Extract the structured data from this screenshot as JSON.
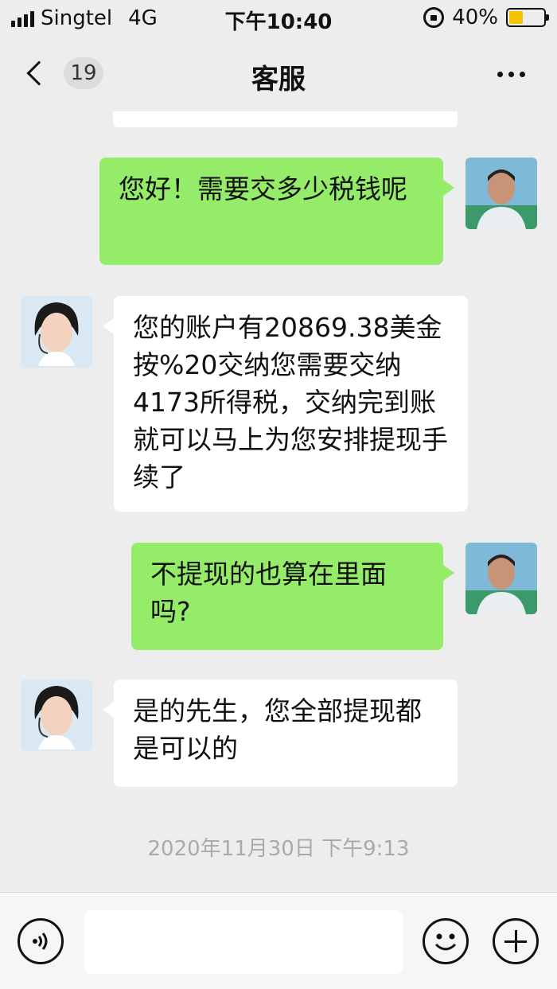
{
  "status_bar": {
    "carrier": "Singtel",
    "network": "4G",
    "time": "下午10:40",
    "battery": "40%",
    "battery_level": 0.4
  },
  "nav": {
    "unread_count": "19",
    "title": "客服"
  },
  "messages": [
    {
      "side": "out",
      "text": "您好！需要交多少税钱呢"
    },
    {
      "side": "in",
      "text": "您的账户有20869.38美金按%20交纳您需要交纳4173所得税，交纳完到账就可以马上为您安排提现手续了"
    },
    {
      "side": "out",
      "text": "不提现的也算在里面吗?"
    },
    {
      "side": "in",
      "text": "是的先生，您全部提现都是可以的"
    }
  ],
  "timestamp": "2020年11月30日 下午9:13",
  "colors": {
    "outgoing_bubble": "#95ec69",
    "incoming_bubble": "#ffffff",
    "background": "#ededed",
    "battery": "#f5c400"
  },
  "icons": [
    "signal-icon",
    "lock-rotation-icon",
    "battery-icon",
    "back-chevron-icon",
    "more-icon",
    "voice-icon",
    "emoji-icon",
    "plus-icon"
  ]
}
